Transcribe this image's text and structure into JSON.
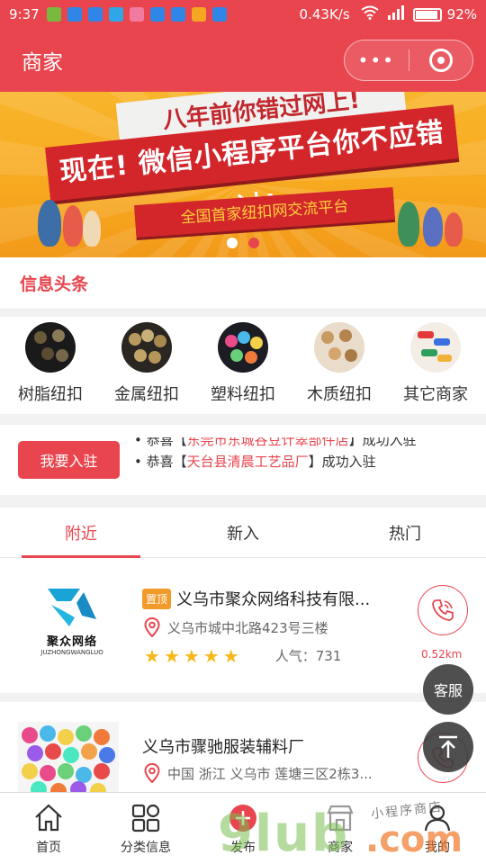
{
  "status_bar": {
    "time": "9:37",
    "network_speed": "0.43K/s",
    "battery": "92%"
  },
  "nav": {
    "title": "商家",
    "more": "•••"
  },
  "banner": {
    "line_top": "八年前你错过网上!",
    "line_main": "现在! 微信小程序平台你不应错过!",
    "line_sub": "全国首家纽扣网交流平台",
    "slide_count": 2,
    "active_slide": 2
  },
  "headline": {
    "title": "信息头条"
  },
  "categories": [
    {
      "label": "树脂纽扣",
      "icon": "resin-button-icon"
    },
    {
      "label": "金属纽扣",
      "icon": "metal-button-icon"
    },
    {
      "label": "塑料纽扣",
      "icon": "plastic-button-icon"
    },
    {
      "label": "木质纽扣",
      "icon": "wood-button-icon"
    },
    {
      "label": "其它商家",
      "icon": "other-merchant-icon"
    }
  ],
  "join": {
    "button_label": "我要入驻",
    "ticker": [
      {
        "prefix": "• 恭喜【",
        "highlight": "东莞市东城谷豆计翠部件店",
        "suffix": "】成功入驻"
      },
      {
        "prefix": "• 恭喜【",
        "highlight": "天台县清晨工艺品厂",
        "suffix": "】成功入驻"
      }
    ]
  },
  "tabs": [
    {
      "label": "附近",
      "active": true
    },
    {
      "label": "新入",
      "active": false
    },
    {
      "label": "热门",
      "active": false
    }
  ],
  "listings": [
    {
      "badge": "置顶",
      "name": "义乌市聚众网络科技有限...",
      "address": "义乌市城中北路423号三楼",
      "stars": 5,
      "popularity_label": "人气：731",
      "distance": "0.52km",
      "logo_cn": "聚众网络",
      "logo_en": "JUZHONGWANGLUO"
    },
    {
      "badge": "",
      "name": "义乌市骤驰服装辅料厂",
      "address": "中国 浙江 义乌市 莲塘三区2栋3...",
      "stars": 0,
      "popularity_label": "",
      "distance": ""
    }
  ],
  "floating": {
    "service_label": "客服"
  },
  "tabbar": [
    {
      "label": "首页",
      "icon": "home-icon"
    },
    {
      "label": "分类信息",
      "icon": "grid-icon"
    },
    {
      "label": "发布",
      "icon": "publish-icon"
    },
    {
      "label": "商家",
      "icon": "shop-icon"
    },
    {
      "label": "我的",
      "icon": "user-icon"
    }
  ],
  "watermark": {
    "big": "9lub",
    "com": ".com",
    "small": "小程序商店"
  },
  "colors": {
    "brand_red": "#e8454e",
    "badge_orange": "#f29b2a",
    "star_yellow": "#f6b81a"
  }
}
